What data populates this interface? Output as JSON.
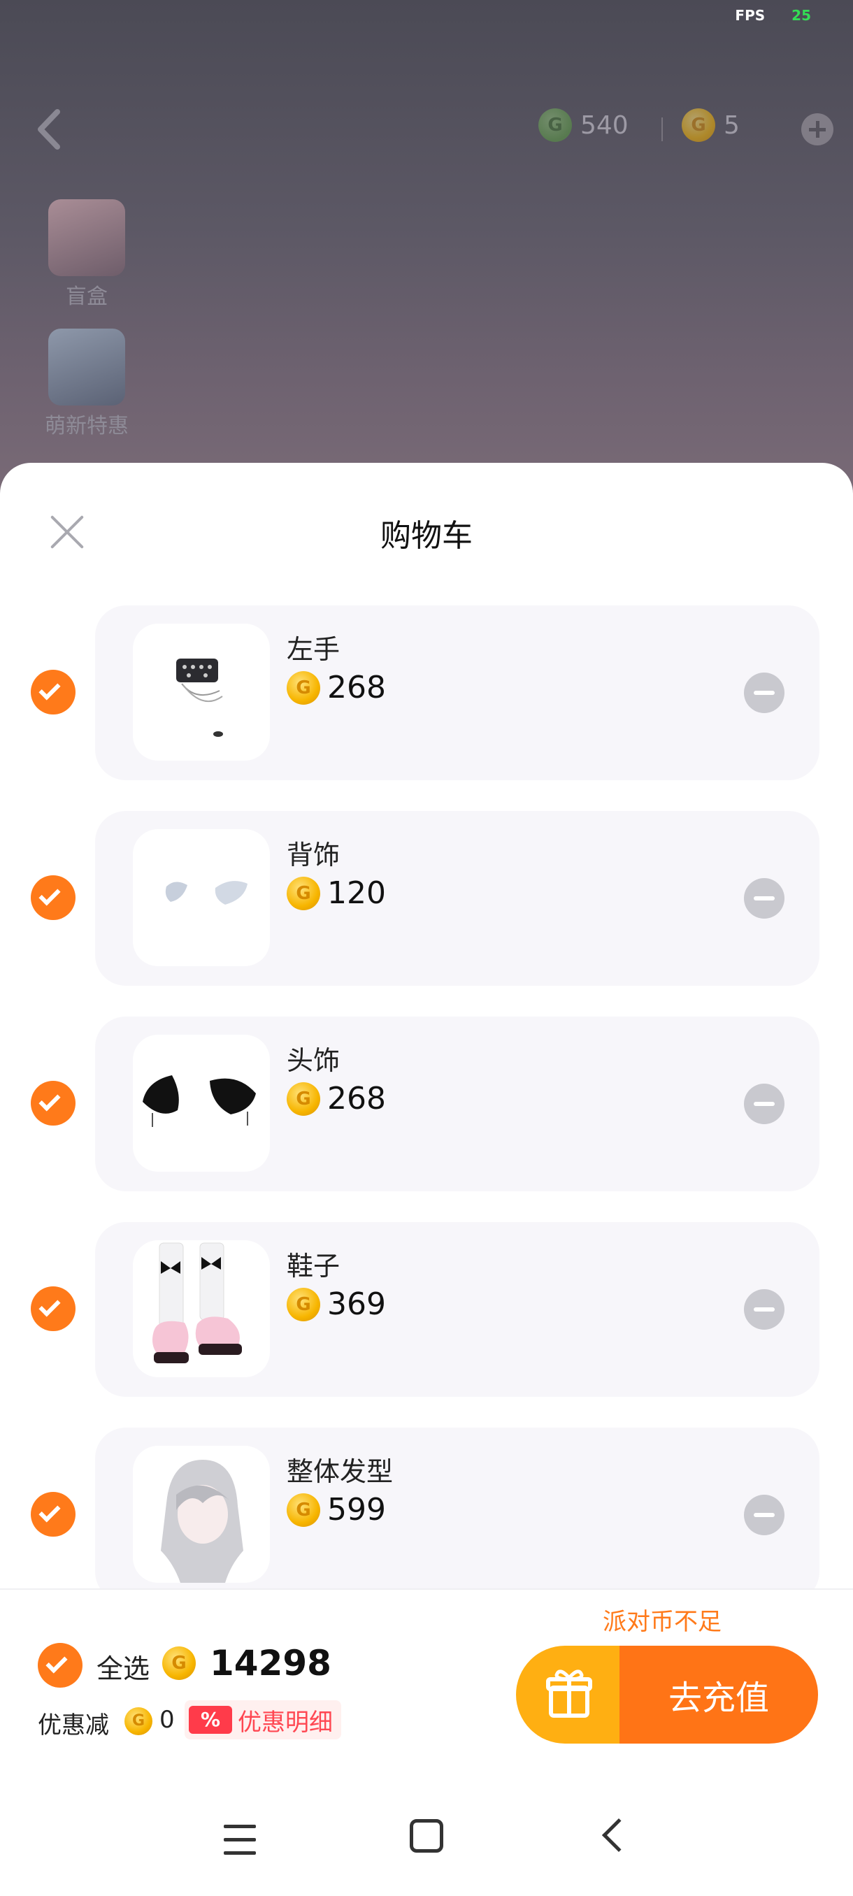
{
  "fps": {
    "label": "FPS",
    "value": "25"
  },
  "top_bar": {
    "back_icon": "chevron-left-icon",
    "currencies": [
      {
        "icon": "green-coin-icon",
        "value": "540"
      },
      {
        "icon": "gold-coin-icon",
        "value": "5"
      }
    ],
    "add_icon": "plus-icon"
  },
  "side_menu": [
    {
      "label": "盲盒",
      "icon": "gift-box-icon"
    },
    {
      "label": "萌新特惠",
      "icon": "newbie-offer-icon"
    }
  ],
  "sheet": {
    "title": "购物车",
    "close_icon": "close-icon"
  },
  "cart_items": [
    {
      "name": "左手",
      "price": "268",
      "checked": true,
      "image": "studded-cuff-bracelet"
    },
    {
      "name": "背饰",
      "price": "120",
      "checked": true,
      "image": "small-white-wings"
    },
    {
      "name": "头饰",
      "price": "268",
      "checked": true,
      "image": "black-fluffy-cat-ears"
    },
    {
      "name": "鞋子",
      "price": "369",
      "checked": true,
      "image": "white-socks-pink-platform-shoes"
    },
    {
      "name": "整体发型",
      "price": "599",
      "checked": true,
      "image": "silver-long-hairstyle"
    }
  ],
  "footer": {
    "select_all_label": "全选",
    "total": "14298",
    "discount_label": "优惠减",
    "discount_value": "0",
    "discount_badge": "%",
    "discount_detail": "优惠明细",
    "insufficient_text": "派对币不足",
    "recharge_label": "去充值",
    "gift_icon": "gift-icon"
  },
  "nav_bar": {
    "menu_icon": "menu-icon",
    "home_icon": "home-icon",
    "back_icon": "back-icon"
  },
  "colors": {
    "accent": "#ff7a1a",
    "gift_button": "#ffaf12",
    "discount_red": "#ff3b4a",
    "coin_gold": "#f7b500"
  }
}
